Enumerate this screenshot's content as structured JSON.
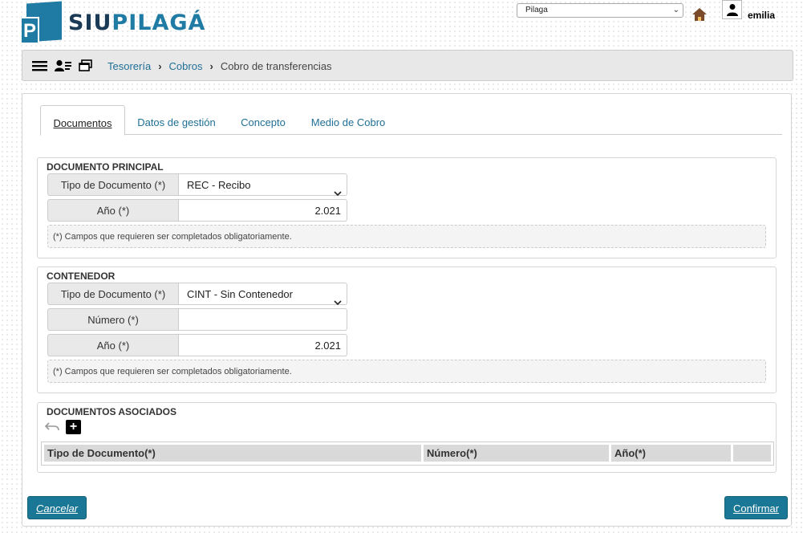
{
  "header": {
    "logo_letter": "P",
    "logo_part1": "SIU",
    "logo_part2": "PILAGÁ",
    "unit_selected": "Pilaga",
    "user_name": "emilia"
  },
  "breadcrumb": {
    "items": [
      "Tesorería",
      "Cobros",
      "Cobro de transferencias"
    ]
  },
  "tabs": [
    {
      "label": "Documentos",
      "active": true
    },
    {
      "label": "Datos de gestión"
    },
    {
      "label": "Concepto"
    },
    {
      "label": "Medio de Cobro"
    }
  ],
  "documento_principal": {
    "title": "DOCUMENTO PRINCIPAL",
    "tipo_label": "Tipo de Documento (*)",
    "tipo_value": "REC - Recibo",
    "anio_label": "Año (*)",
    "anio_value": "2.021",
    "note": "(*) Campos que requieren ser completados obligatoriamente."
  },
  "contenedor": {
    "title": "CONTENEDOR",
    "tipo_label": "Tipo de Documento (*)",
    "tipo_value": "CINT - Sin Contenedor",
    "numero_label": "Número (*)",
    "numero_value": "",
    "anio_label": "Año (*)",
    "anio_value": "2.021",
    "note": "(*) Campos que requieren ser completados obligatoriamente."
  },
  "documentos_asociados": {
    "title": "DOCUMENTOS ASOCIADOS",
    "columns": [
      "Tipo de Documento(*)",
      "Número(*)",
      "Año(*)"
    ]
  },
  "actions": {
    "cancel_label": "Cancelar",
    "confirm_label": "Confirmar"
  },
  "colors": {
    "brand": "#1f7ba3",
    "link": "#1f6f97",
    "button": "#1a7896"
  }
}
